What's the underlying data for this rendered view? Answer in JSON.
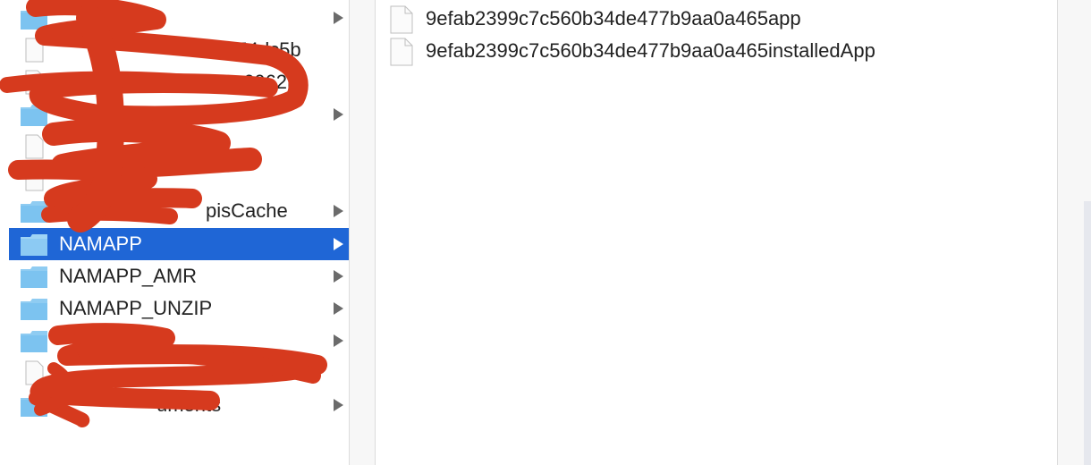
{
  "left_column": {
    "items": [
      {
        "kind": "folder",
        "label": "",
        "has_children": true
      },
      {
        "kind": "file",
        "label": "4854dc5b",
        "has_children": false
      },
      {
        "kind": "file",
        "label": "6062b1",
        "has_children": false
      },
      {
        "kind": "folder",
        "label": "",
        "has_children": true
      },
      {
        "kind": "file",
        "label": "",
        "has_children": false
      },
      {
        "kind": "file",
        "label": "",
        "has_children": false
      },
      {
        "kind": "folder",
        "label": "pisCache",
        "has_children": true
      },
      {
        "kind": "folder",
        "label": "NAMAPP",
        "has_children": true,
        "selected": true
      },
      {
        "kind": "folder",
        "label": "NAMAPP_AMR",
        "has_children": true
      },
      {
        "kind": "folder",
        "label": "NAMAPP_UNZIP",
        "has_children": true
      },
      {
        "kind": "folder",
        "label": "",
        "has_children": true
      },
      {
        "kind": "file",
        "label": "",
        "has_children": false
      },
      {
        "kind": "folder",
        "label": "uments",
        "has_children": true
      }
    ]
  },
  "right_column": {
    "items": [
      {
        "kind": "file",
        "label": "9efab2399c7c560b34de477b9aa0a465app"
      },
      {
        "kind": "file",
        "label": "9efab2399c7c560b34de477b9aa0a465installedApp"
      }
    ]
  },
  "colors": {
    "selection": "#1f66d6",
    "folder": "#7cc3f0",
    "redaction": "#d63a1e"
  }
}
